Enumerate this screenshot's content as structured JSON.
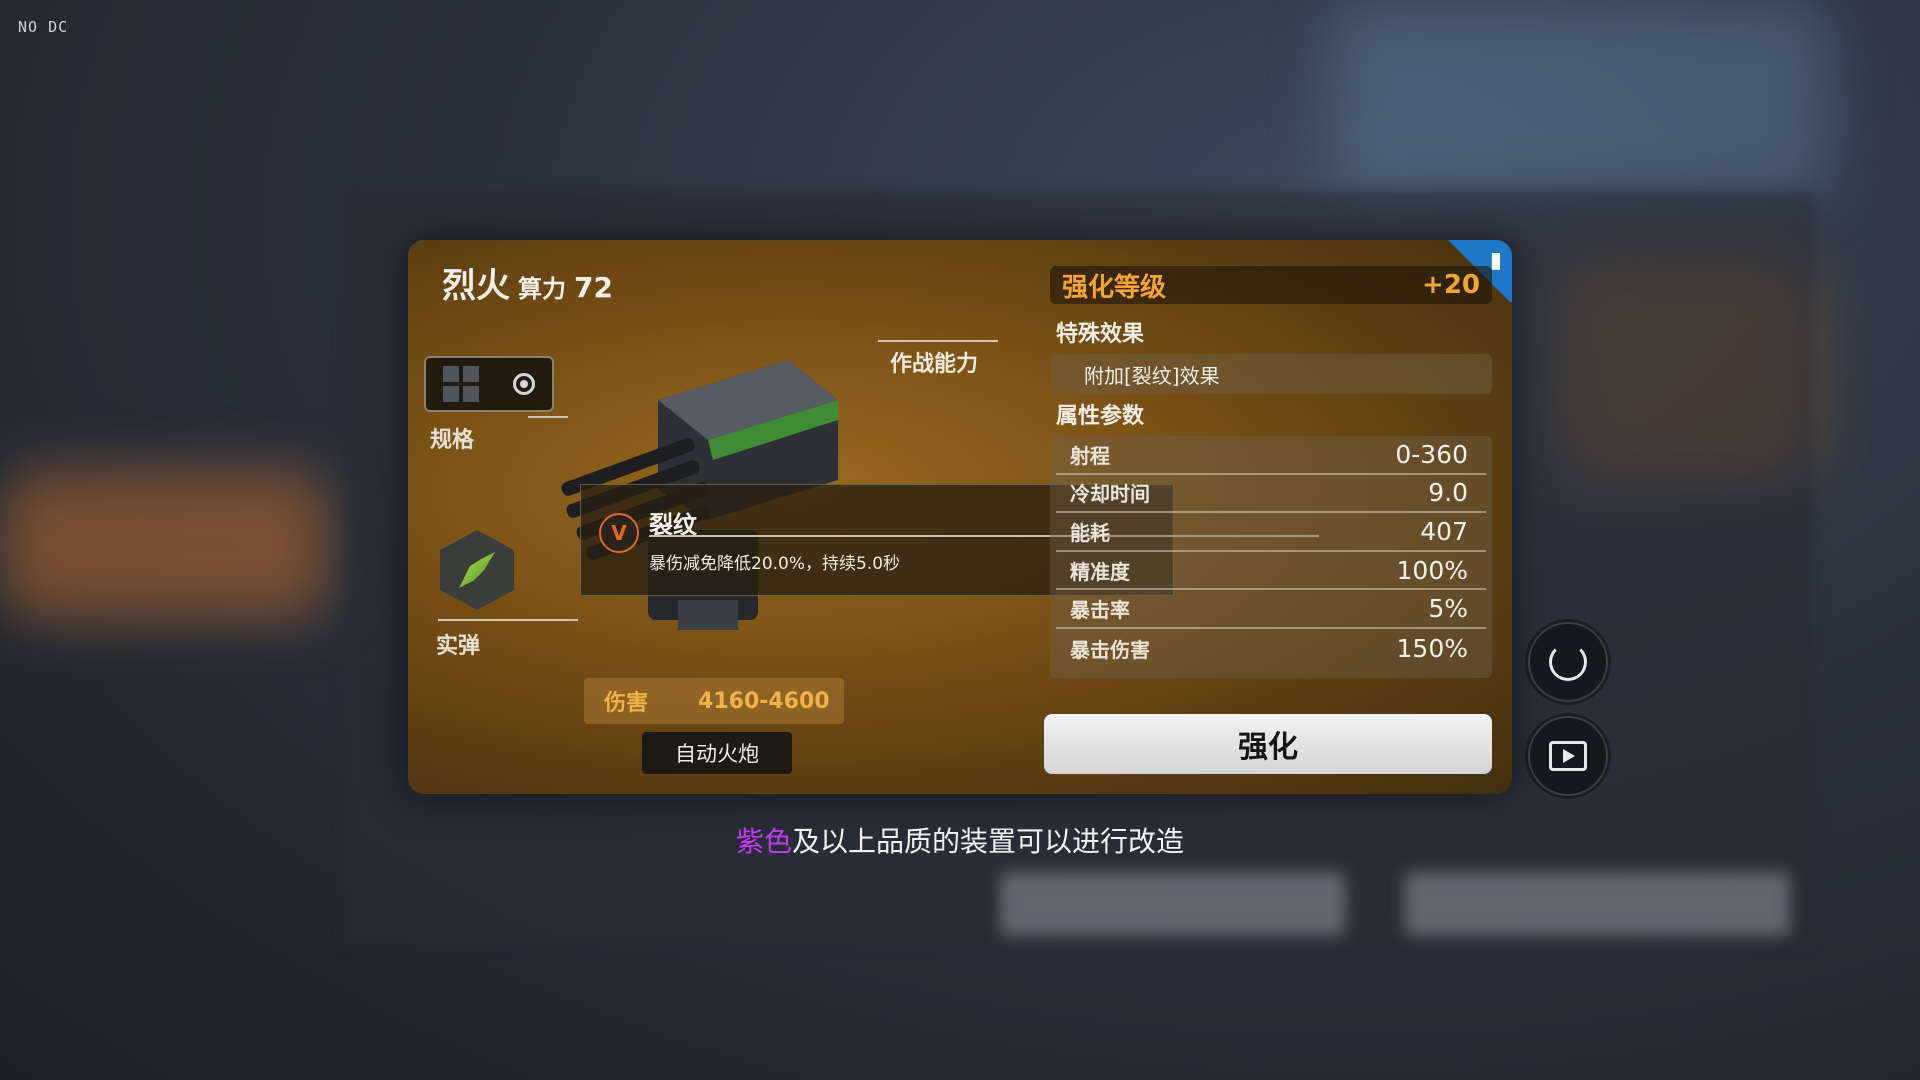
{
  "corner_tag": "NO DC",
  "item": {
    "name": "烈火",
    "power_label": "算力",
    "power_value": "72",
    "spec_label": "规格",
    "ammo_label": "实弹",
    "combat_label": "作战能力",
    "damage_label": "伤害",
    "damage_value": "4160-4600",
    "type_label": "自动火炮"
  },
  "tooltip": {
    "icon": "fissure-icon",
    "title": "裂纹",
    "desc": "暴伤减免降低20.0%，持续5.0秒"
  },
  "right_panel": {
    "enhance_label": "强化等级",
    "enhance_value": "+20",
    "special_title": "特殊效果",
    "special_effect": "附加[裂纹]效果",
    "attr_title": "属性参数",
    "stats": [
      {
        "name": "射程",
        "value": "0-360"
      },
      {
        "name": "冷却时间",
        "value": "9.0"
      },
      {
        "name": "能耗",
        "value": "407"
      },
      {
        "name": "精准度",
        "value": "100%"
      },
      {
        "name": "暴击率",
        "value": "5%"
      },
      {
        "name": "暴击伤害",
        "value": "150%"
      }
    ],
    "upgrade_label": "强化"
  },
  "caption": {
    "accent": "紫色",
    "rest": "及以上品质的装置可以进行改造"
  },
  "colors": {
    "accent_orange": "#f3a431",
    "caption_purple": "#c43cf0",
    "corner_blue": "#1f79c8"
  }
}
